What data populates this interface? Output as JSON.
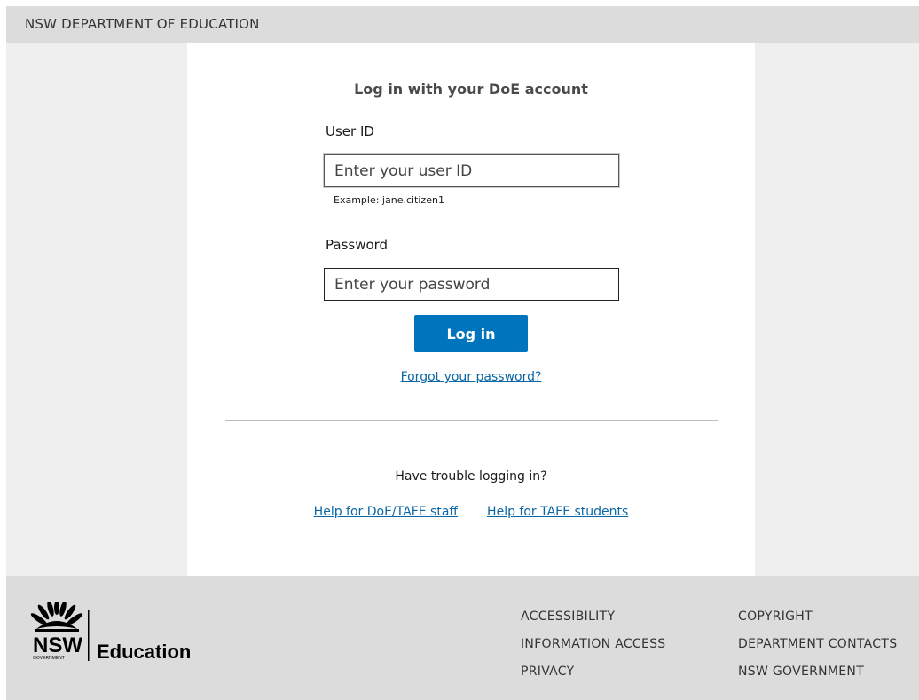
{
  "header": {
    "title": "NSW DEPARTMENT OF EDUCATION"
  },
  "login": {
    "heading": "Log in with your DoE account",
    "user_id_label": "User ID",
    "user_id_placeholder": "Enter your user ID",
    "user_id_hint": "Example: jane.citizen1",
    "password_label": "Password",
    "password_placeholder": "Enter your password",
    "submit_label": "Log in",
    "forgot_link": "Forgot your password?"
  },
  "help": {
    "trouble_text": "Have trouble logging in?",
    "staff_link": "Help for DoE/TAFE staff",
    "students_link": "Help for TAFE students"
  },
  "footer": {
    "logo": {
      "icon": "waratah-icon",
      "wordmark": "NSW",
      "subtext": "GOVERNMENT",
      "department": "Education"
    },
    "column1": [
      "ACCESSIBILITY",
      "INFORMATION ACCESS",
      "PRIVACY"
    ],
    "column2": [
      "COPYRIGHT",
      "DEPARTMENT CONTACTS",
      "NSW GOVERNMENT"
    ]
  },
  "colors": {
    "primary_button": "#0075be",
    "link": "#0a66a5",
    "header_background": "#dcdcdc",
    "page_background": "#efefef"
  }
}
